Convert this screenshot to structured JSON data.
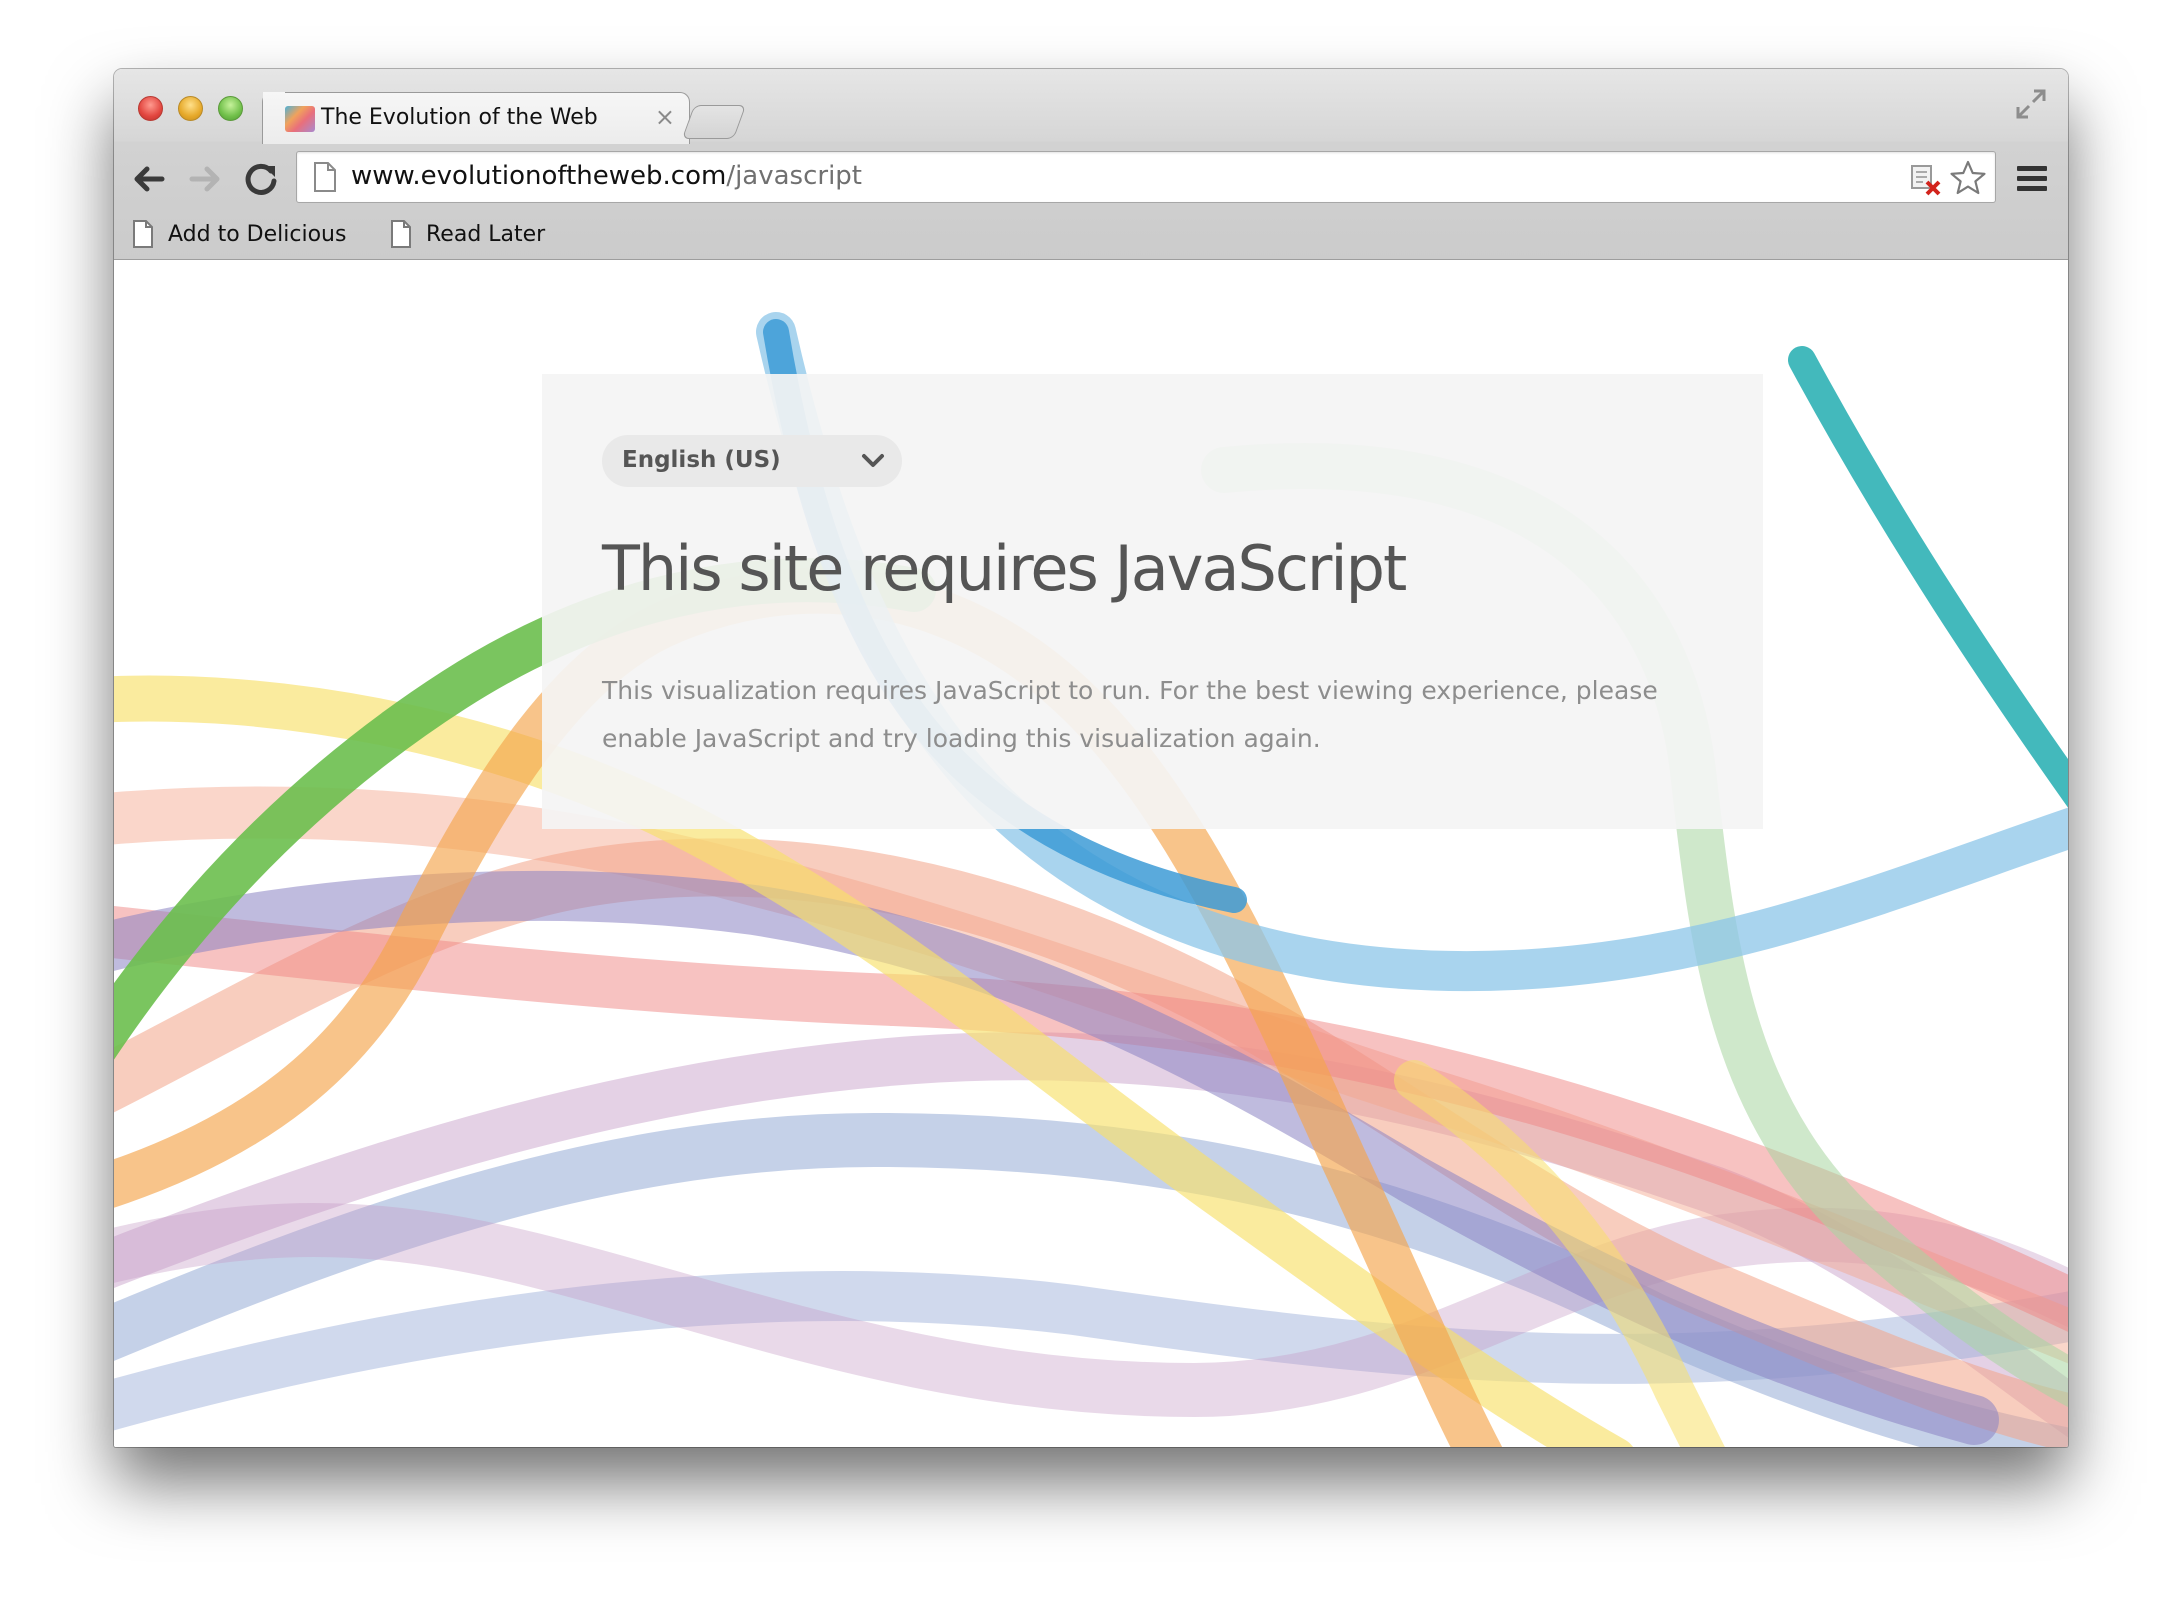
{
  "browser": {
    "tab": {
      "title": "The Evolution of the Web",
      "close_glyph": "×",
      "favicon": "evolution-of-the-web-favicon"
    },
    "address_bar": {
      "host": "www.evolutionoftheweb.com",
      "path": "/javascript"
    },
    "bookmarks": [
      {
        "label": "Add to Delicious",
        "icon": "page-icon"
      },
      {
        "label": "Read Later",
        "icon": "page-icon"
      }
    ],
    "icons": {
      "back": "arrow-left-icon",
      "forward": "arrow-right-icon",
      "reload": "reload-icon",
      "extension": "extension-blocked-icon",
      "bookmark_star": "star-icon",
      "menu": "hamburger-menu-icon",
      "fullscreen": "fullscreen-icon"
    }
  },
  "page": {
    "language_select": {
      "selected": "English (US)"
    },
    "headline": "This site requires JavaScript",
    "message": "This visualization requires JavaScript to run. For the best viewing experience, please enable JavaScript and try loading this visualization again."
  },
  "colors": {
    "ribbon_green": "#6bbf4e",
    "ribbon_yellow": "#f7e06a",
    "ribbon_orange": "#f4a44c",
    "ribbon_salmon": "#f3a489",
    "ribbon_red": "#ef8683",
    "ribbon_purple": "#9c8fcb",
    "ribbon_mauve": "#c49ac6",
    "ribbon_blue": "#3d9bd6",
    "ribbon_lightblue": "#8cc6e8",
    "ribbon_periwinkle": "#96abd6",
    "ribbon_teal": "#2fb1b5",
    "ribbon_lightgreen": "#a8d6a0"
  }
}
